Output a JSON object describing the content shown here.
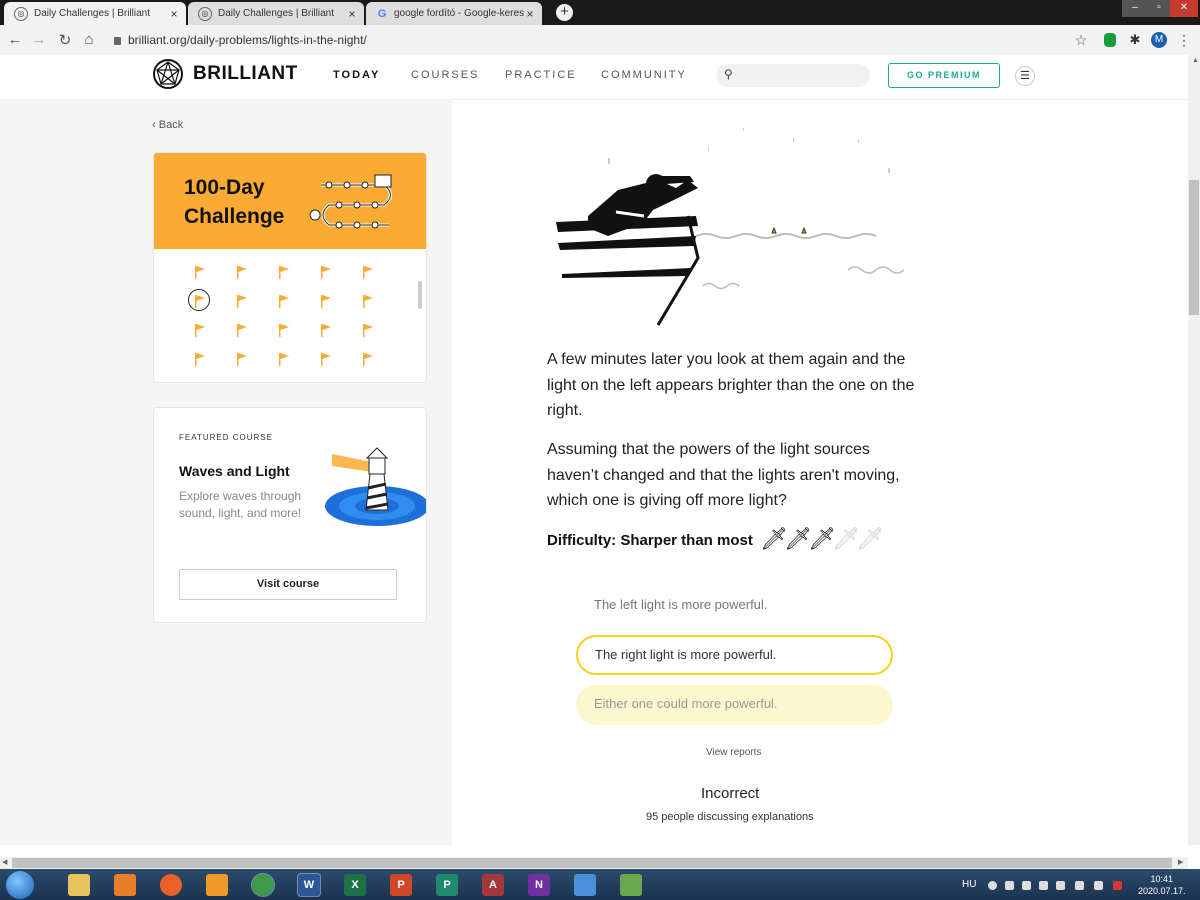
{
  "browser": {
    "tabs": [
      {
        "title": "Daily Challenges | Brilliant",
        "active": true
      },
      {
        "title": "Daily Challenges | Brilliant",
        "active": false
      },
      {
        "title": "google fordító - Google-keresés",
        "active": false
      }
    ],
    "close_glyph": "×",
    "new_tab_glyph": "+",
    "url": "brilliant.org/daily-problems/lights-in-the-night/",
    "profile_initial": "M"
  },
  "site": {
    "logo_text": "BRILLIANT",
    "nav": [
      "TODAY",
      "COURSES",
      "PRACTICE",
      "COMMUNITY"
    ],
    "premium_label": "GO PREMIUM",
    "accent": "#1ea896"
  },
  "sidebar": {
    "back_label": "Back",
    "challenge_title_line1": "100-Day",
    "challenge_title_line2": "Challenge",
    "challenge_color": "#fbaa33",
    "featured_label": "FEATURED COURSE",
    "featured_name": "Waves and Light",
    "featured_desc": "Explore waves through sound, light, and more!",
    "visit_label": "Visit course"
  },
  "problem": {
    "paragraph1": "A few minutes later you look at them again and the light on the left appears brighter than the one on the right.",
    "paragraph2": "Assuming that the powers of the light sources haven’t changed and that the lights aren't moving, which one is giving off more light?",
    "difficulty_label": "Difficulty: Sharper than most",
    "difficulty_level": 3,
    "difficulty_max": 5,
    "options": [
      {
        "label": "The left light is more powerful.",
        "state": "plain"
      },
      {
        "label": "The right light is more powerful.",
        "state": "selected"
      },
      {
        "label": "Either one could more powerful.",
        "state": "highlight"
      }
    ],
    "view_reports": "View reports",
    "result": "Incorrect",
    "discussion": "95 people discussing explanations"
  },
  "taskbar": {
    "apps": [
      "explorer",
      "media-player",
      "firefox",
      "sublime",
      "chrome",
      "word",
      "excel",
      "powerpoint",
      "publisher",
      "access",
      "onenote",
      "paint",
      "minecraft"
    ],
    "language": "HU",
    "time": "10:41",
    "date": "2020.07.17."
  }
}
